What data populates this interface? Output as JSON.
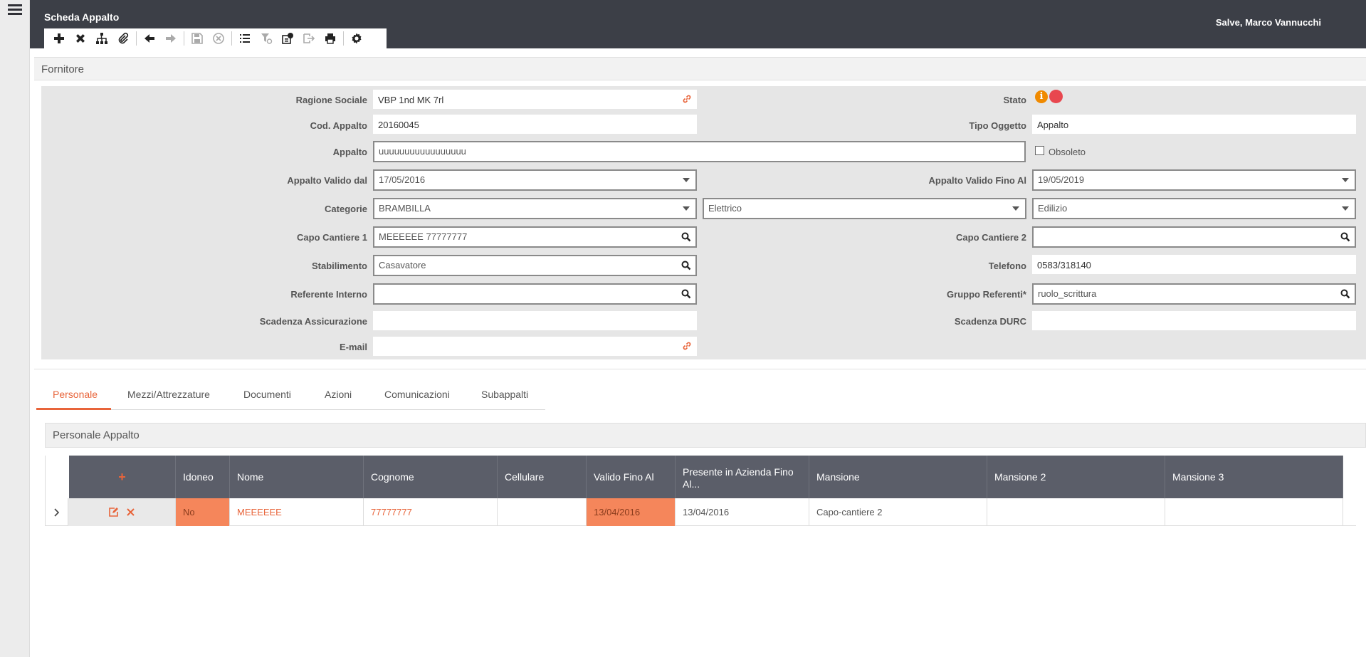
{
  "header": {
    "title": "Scheda Appalto",
    "greeting": "Salve, Marco Vannucchi"
  },
  "toolbar": {
    "buttons": [
      "add",
      "delete",
      "hierarchy",
      "attach",
      "back",
      "forward",
      "save",
      "cancel",
      "list",
      "filter-clear",
      "info",
      "export",
      "print",
      "settings"
    ]
  },
  "section": {
    "title": "Fornitore"
  },
  "form": {
    "ragione_sociale": {
      "label": "Ragione Sociale",
      "value": "VBP 1nd MK 7rl"
    },
    "stato": {
      "label": "Stato"
    },
    "cod_appalto": {
      "label": "Cod. Appalto",
      "value": "20160045"
    },
    "tipo_oggetto": {
      "label": "Tipo Oggetto",
      "value": "Appalto"
    },
    "appalto": {
      "label": "Appalto",
      "value": "uuuuuuuuuuuuuuuuu"
    },
    "obsoleto": {
      "label": "Obsoleto",
      "checked": false
    },
    "valido_dal": {
      "label": "Appalto Valido dal",
      "value": "17/05/2016"
    },
    "valido_al": {
      "label": "Appalto Valido Fino Al",
      "value": "19/05/2019"
    },
    "categorie": {
      "label": "Categorie",
      "values": [
        "BRAMBILLA",
        "Elettrico",
        "Edilizio"
      ]
    },
    "capo_cantiere_1": {
      "label": "Capo Cantiere 1",
      "value": "MEEEEEE 77777777"
    },
    "capo_cantiere_2": {
      "label": "Capo Cantiere 2",
      "value": ""
    },
    "stabilimento": {
      "label": "Stabilimento",
      "value": "Casavatore"
    },
    "telefono": {
      "label": "Telefono",
      "value": "0583/318140"
    },
    "referente_interno": {
      "label": "Referente Interno",
      "value": ""
    },
    "gruppo_referenti": {
      "label": "Gruppo Referenti*",
      "value": "ruolo_scrittura"
    },
    "scadenza_assicurazione": {
      "label": "Scadenza Assicurazione",
      "value": ""
    },
    "scadenza_durc": {
      "label": "Scadenza DURC",
      "value": ""
    },
    "email": {
      "label": "E-mail",
      "value": ""
    }
  },
  "tabs": [
    {
      "label": "Personale",
      "active": true
    },
    {
      "label": "Mezzi/Attrezzature",
      "active": false
    },
    {
      "label": "Documenti",
      "active": false
    },
    {
      "label": "Azioni",
      "active": false
    },
    {
      "label": "Comunicazioni",
      "active": false
    },
    {
      "label": "Subappalti",
      "active": false
    }
  ],
  "subsection": {
    "title": "Personale Appalto"
  },
  "table": {
    "add_symbol": "+",
    "columns": [
      "Idoneo",
      "Nome",
      "Cognome",
      "Cellulare",
      "Valido Fino Al",
      "Presente in Azienda Fino Al...",
      "Mansione",
      "Mansione 2",
      "Mansione 3"
    ],
    "rows": [
      {
        "idoneo": "No",
        "nome": "MEEEEEE",
        "cognome": "77777777",
        "cellulare": "",
        "valido_fino_al": "13/04/2016",
        "presente_fino_al": "13/04/2016",
        "mansione": "Capo-cantiere 2",
        "mansione_2": "",
        "mansione_3": ""
      }
    ]
  },
  "colors": {
    "topbar": "#3c3f47",
    "accent": "#e8643a",
    "warning_cell": "#f5865b",
    "status_info": "#f08a00",
    "status_dot": "#e8474f",
    "table_header": "#5b5e69"
  }
}
